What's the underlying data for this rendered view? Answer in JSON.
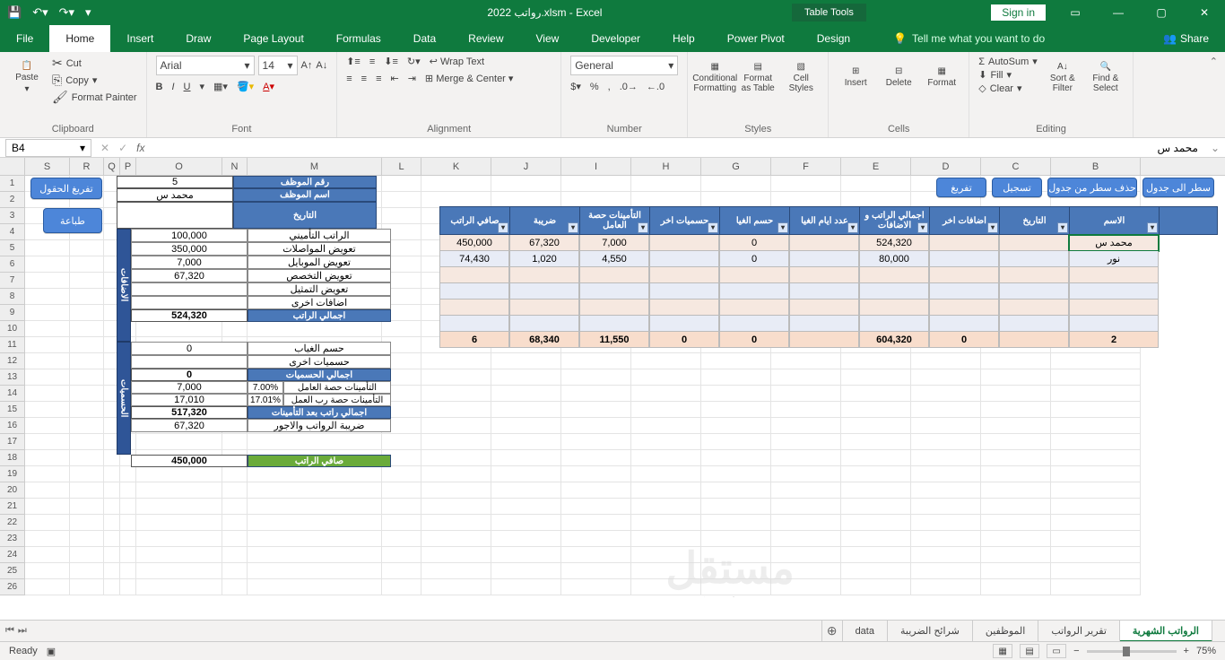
{
  "title": "رواتب 2022.xlsm - Excel",
  "context_tab": "Table Tools",
  "signin": "Sign in",
  "tabs": [
    "File",
    "Home",
    "Insert",
    "Draw",
    "Page Layout",
    "Formulas",
    "Data",
    "Review",
    "View",
    "Developer",
    "Help",
    "Power Pivot",
    "Design"
  ],
  "active_tab": "Home",
  "tellme": "Tell me what you want to do",
  "share": "Share",
  "ribbon": {
    "clipboard": {
      "paste": "Paste",
      "cut": "Cut",
      "copy": "Copy",
      "fp": "Format Painter",
      "label": "Clipboard"
    },
    "font": {
      "name": "Arial",
      "size": "14",
      "label": "Font"
    },
    "alignment": {
      "wrap": "Wrap Text",
      "merge": "Merge & Center",
      "label": "Alignment"
    },
    "number": {
      "fmt": "General",
      "label": "Number"
    },
    "styles": {
      "cf": "Conditional Formatting",
      "fat": "Format as Table",
      "cs": "Cell Styles",
      "label": "Styles"
    },
    "cells": {
      "ins": "Insert",
      "del": "Delete",
      "fmt": "Format",
      "label": "Cells"
    },
    "editing": {
      "as": "AutoSum",
      "fill": "Fill",
      "clr": "Clear",
      "sort": "Sort & Filter",
      "find": "Find & Select",
      "label": "Editing"
    }
  },
  "namebox": "B4",
  "formula": "محمد س",
  "buttons": {
    "clear_fields": "تفريغ الحقول",
    "print": "طباعة",
    "discharge": "تفريغ",
    "register": "تسجيل",
    "del_row": "حذف سطر من جدول",
    "add_row": "سطر الى جدول"
  },
  "side": {
    "adds": "الاضافات",
    "deds": "الحسميات"
  },
  "left_table": {
    "emp_no": {
      "label": "رقم الموظف",
      "val": "5"
    },
    "emp_name": {
      "label": "اسم الموظف",
      "val": "محمد س"
    },
    "date": {
      "label": "التاريخ",
      "val": ""
    },
    "rows": [
      {
        "label": "الراتب التأميني",
        "val": "100,000"
      },
      {
        "label": "تعويض المواصلات",
        "val": "350,000"
      },
      {
        "label": "تعويض الموبايل",
        "val": "7,000"
      },
      {
        "label": "تعويض التخصص",
        "val": "67,320"
      },
      {
        "label": "تعويض التمثيل",
        "val": ""
      },
      {
        "label": "اضافات اخرى",
        "val": ""
      }
    ],
    "gross": {
      "label": "اجمالي الراتب",
      "val": "524,320"
    },
    "absence": {
      "label": "حسم الغياب",
      "val": "0"
    },
    "other_ded": {
      "label": "حسميات اخرى",
      "val": ""
    },
    "total_ded": {
      "label": "اجمالي الحسميات",
      "val": "0"
    },
    "ins_emp": {
      "label": "التأمينات حصة العامل",
      "pct": "7.00%",
      "val": "7,000"
    },
    "ins_er": {
      "label": "التأمينات حصة رب العمل",
      "pct": "17.01%",
      "val": "17,010"
    },
    "after_ins": {
      "label": "اجمالي راتب بعد التأمينات",
      "val": "517,320"
    },
    "tax": {
      "label": "ضريبة الرواتب والاجور",
      "val": "67,320"
    },
    "net": {
      "label": "صافي الراتب",
      "val": "450,000"
    }
  },
  "main_table": {
    "headers": [
      "الاسم",
      "التاريخ",
      "اضافات اخر",
      "اجمالي الراتب و الاضافات",
      "عدد ايام الغيا",
      "حسم الغيا",
      "حسميات اخر",
      "التأمينات حصة العامل",
      "ضريبة",
      "صافي الراتب"
    ],
    "rows": [
      {
        "name": "محمد س",
        "vals": [
          "",
          "",
          "524,320",
          "",
          "0",
          "",
          "7,000",
          "67,320",
          "450,000"
        ]
      },
      {
        "name": "نور",
        "vals": [
          "",
          "",
          "80,000",
          "",
          "0",
          "",
          "4,550",
          "1,020",
          "74,430"
        ]
      }
    ],
    "totals": [
      "2",
      "",
      "0",
      "604,320",
      "",
      "0",
      "0",
      "11,550",
      "68,340",
      "6"
    ]
  },
  "cols": [
    "S",
    "R",
    "Q",
    "P",
    "O",
    "N",
    "M",
    "L",
    "K",
    "J",
    "I",
    "H",
    "G",
    "F",
    "E",
    "D",
    "C",
    "B"
  ],
  "sheets": [
    "الرواتب الشهرية",
    "تقرير الرواتب",
    "الموظفين",
    "شرائح الضريبة",
    "data"
  ],
  "active_sheet": 0,
  "status": "Ready",
  "zoom": "75%"
}
